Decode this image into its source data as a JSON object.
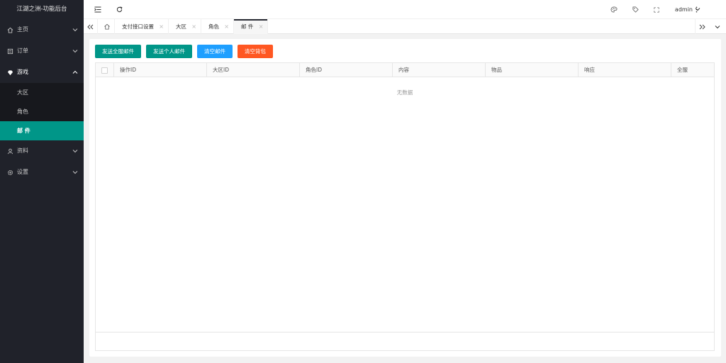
{
  "app": {
    "title": "江湖之洲-功能后台"
  },
  "sidebar": {
    "items": [
      {
        "label": "主页",
        "icon": "home-icon",
        "open": false
      },
      {
        "label": "订单",
        "icon": "order-icon",
        "open": false
      },
      {
        "label": "游戏",
        "icon": "diamond-icon",
        "open": true,
        "children": [
          {
            "label": "大区",
            "active": false
          },
          {
            "label": "角色",
            "active": false
          },
          {
            "label": "邮 件",
            "active": true
          }
        ]
      },
      {
        "label": "资料",
        "icon": "user-icon",
        "open": false
      },
      {
        "label": "设置",
        "icon": "gear-icon",
        "open": false
      }
    ]
  },
  "header": {
    "user": "admin"
  },
  "tabs": [
    {
      "label": "支付接口设置",
      "active": false
    },
    {
      "label": "大区",
      "active": false
    },
    {
      "label": "角色",
      "active": false
    },
    {
      "label": "邮 件",
      "active": true
    }
  ],
  "toolbar": {
    "send_all": "发送全服邮件",
    "send_personal": "发送个人邮件",
    "clear_mail": "清空邮件",
    "clear_bag": "清空背包"
  },
  "table": {
    "columns": [
      "操作ID",
      "大区ID",
      "角色ID",
      "内容",
      "物品",
      "响应",
      "全服"
    ],
    "empty_text": "无数据"
  },
  "colors": {
    "accent": "#009688",
    "blue": "#1e9fff",
    "orange": "#ff5722",
    "sidebar": "#20222a"
  }
}
